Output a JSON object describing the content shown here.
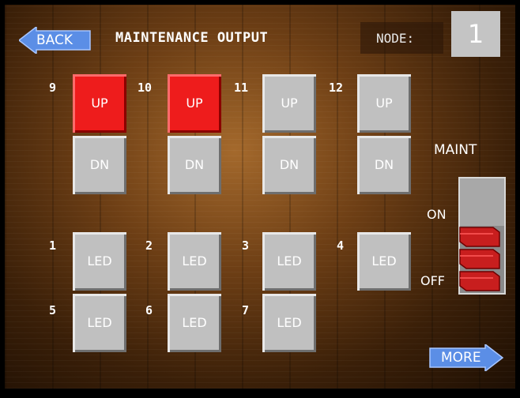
{
  "header": {
    "back_label": "BACK",
    "title": "MAINTENANCE OUTPUT",
    "node_label": "NODE:",
    "node_value": "1"
  },
  "outputs": [
    {
      "number": "9",
      "up_label": "UP",
      "dn_label": "DN",
      "up_active": true
    },
    {
      "number": "10",
      "up_label": "UP",
      "dn_label": "DN",
      "up_active": true
    },
    {
      "number": "11",
      "up_label": "UP",
      "dn_label": "DN",
      "up_active": false
    },
    {
      "number": "12",
      "up_label": "UP",
      "dn_label": "DN",
      "up_active": false
    }
  ],
  "leds": [
    {
      "number": "1",
      "label": "LED"
    },
    {
      "number": "2",
      "label": "LED"
    },
    {
      "number": "3",
      "label": "LED"
    },
    {
      "number": "4",
      "label": "LED"
    },
    {
      "number": "5",
      "label": "LED"
    },
    {
      "number": "6",
      "label": "LED"
    },
    {
      "number": "7",
      "label": "LED"
    }
  ],
  "maint_switch": {
    "label": "MAINT",
    "on_label": "ON",
    "off_label": "OFF",
    "state": "off"
  },
  "footer": {
    "more_label": "MORE"
  },
  "colors": {
    "button_gray": "#c0c0c0",
    "button_active_red": "#ee1c1c",
    "arrow_blue": "#5b8ee6",
    "switch_red": "#c81e1e"
  }
}
